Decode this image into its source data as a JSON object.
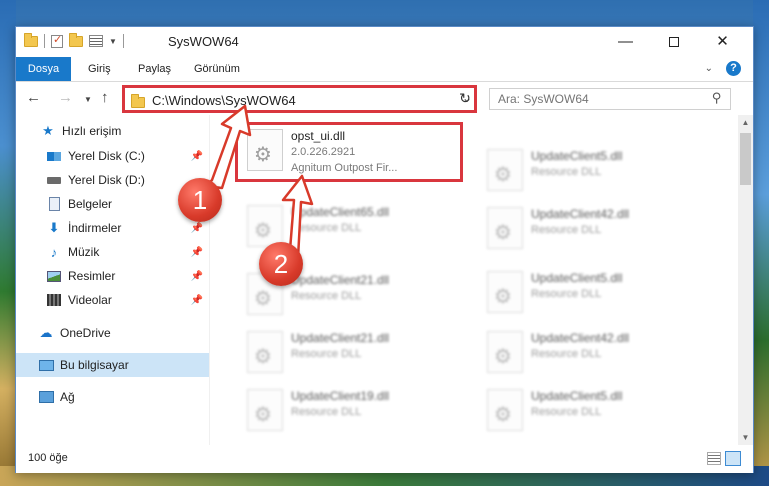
{
  "window": {
    "title": "SysWOW64",
    "minimize": "—",
    "close": "✕"
  },
  "ribbon": {
    "tabs": [
      "Dosya",
      "Giriş",
      "Paylaş",
      "Görünüm"
    ],
    "help": "?"
  },
  "navigation": {
    "address": "C:\\Windows\\SysWOW64",
    "search_placeholder": "Ara: SysWOW64"
  },
  "sidebar": {
    "items": [
      {
        "label": "Hızlı erişim",
        "icon": "star-icon"
      },
      {
        "label": "Yerel Disk (C:)",
        "icon": "drive-icon",
        "pinned": true
      },
      {
        "label": "Yerel Disk (D:)",
        "icon": "drive-icon"
      },
      {
        "label": "Belgeler",
        "icon": "document-icon"
      },
      {
        "label": "İndirmeler",
        "icon": "download-icon",
        "pinned": true
      },
      {
        "label": "Müzik",
        "icon": "music-icon",
        "pinned": true
      },
      {
        "label": "Resimler",
        "icon": "pictures-icon",
        "pinned": true
      },
      {
        "label": "Videolar",
        "icon": "video-icon",
        "pinned": true
      },
      {
        "label": "OneDrive",
        "icon": "cloud-icon"
      },
      {
        "label": "Bu bilgisayar",
        "icon": "computer-icon",
        "selected": true
      },
      {
        "label": "Ağ",
        "icon": "network-icon"
      }
    ]
  },
  "files": {
    "highlighted": {
      "name": "opst_ui.dll",
      "version": "2.0.226.2921",
      "company": "Agnitum Outpost Fir..."
    },
    "col1": [
      {
        "name": "UpdateClient65.dll",
        "type": "Resource DLL"
      },
      {
        "name": "UpdateClient21.dll",
        "type": "Resource DLL"
      },
      {
        "name": "UpdateClient21.dll",
        "type": "Resource DLL"
      },
      {
        "name": "UpdateClient19.dll",
        "type": "Resource DLL"
      }
    ],
    "col2": [
      {
        "name": "UpdateClient5.dll",
        "type": "Resource DLL"
      },
      {
        "name": "UpdateClient42.dll",
        "type": "Resource DLL"
      },
      {
        "name": "UpdateClient5.dll",
        "type": "Resource DLL"
      },
      {
        "name": "UpdateClient42.dll",
        "type": "Resource DLL"
      },
      {
        "name": "UpdateClient5.dll",
        "type": "Resource DLL"
      }
    ]
  },
  "status": {
    "item_count": "100 öğe"
  },
  "callouts": [
    "1",
    "2"
  ],
  "colors": {
    "accent": "#1979ca",
    "highlight": "#d9363e"
  }
}
